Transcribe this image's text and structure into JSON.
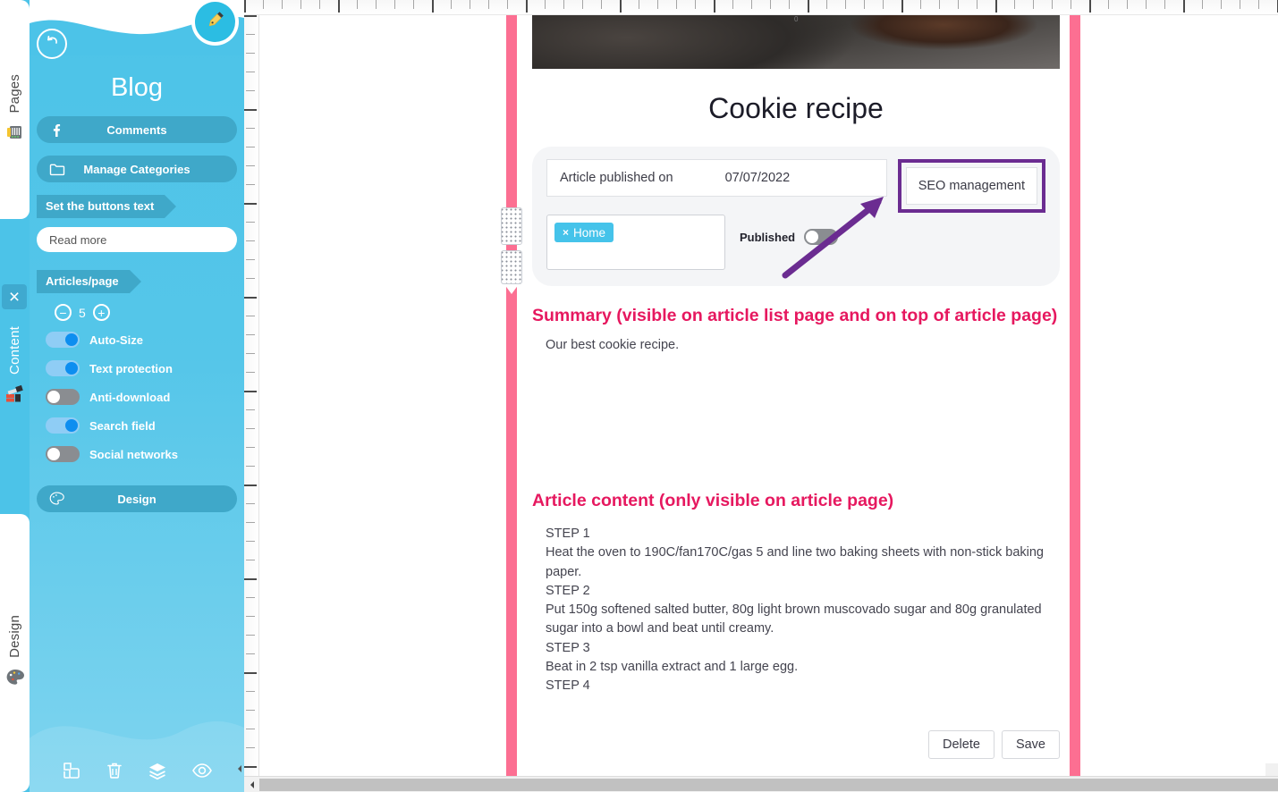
{
  "rail": {
    "tabs": [
      {
        "label": "Pages",
        "icon": "pages-icon",
        "active": false
      },
      {
        "label": "Content",
        "icon": "content-icon",
        "active": true
      },
      {
        "label": "Design",
        "icon": "palette-icon",
        "active": false
      }
    ],
    "close_label": "×"
  },
  "sidebar": {
    "title": "Blog",
    "back_icon": "undo-arrow-icon",
    "pen_icon": "pen-nib-icon",
    "buttons": [
      {
        "label": "Comments",
        "icon": "facebook-icon"
      },
      {
        "label": "Manage Categories",
        "icon": "folder-icon"
      }
    ],
    "buttons_text_tag": "Set the buttons text",
    "read_more": {
      "value": "Read more",
      "placeholder": "Read more"
    },
    "articles_per_page": {
      "tag": "Articles/page",
      "value": "5",
      "minus": "−",
      "plus": "+"
    },
    "toggles": [
      {
        "label": "Auto-Size",
        "state": "on"
      },
      {
        "label": "Text protection",
        "state": "on"
      },
      {
        "label": "Anti-download",
        "state": "off"
      },
      {
        "label": "Search field",
        "state": "on"
      },
      {
        "label": "Social networks",
        "state": "off"
      }
    ],
    "design_button": {
      "label": "Design",
      "icon": "palette-icon"
    },
    "tools": [
      {
        "name": "duplicate-icon"
      },
      {
        "name": "trash-icon"
      },
      {
        "name": "layers-icon"
      },
      {
        "name": "eye-icon"
      }
    ]
  },
  "ruler": {
    "zero_label": "0"
  },
  "article": {
    "hero_image": "cookie-photo",
    "title": "Cookie recipe",
    "published_on_label": "Article published on",
    "published_on_value": "07/07/2022",
    "seo_button": "SEO management",
    "category_chip": {
      "remove": "×",
      "label": "Home"
    },
    "published_toggle": {
      "label": "Published",
      "state": "off"
    },
    "summary_heading": "Summary (visible on article list page and on top of article page)",
    "summary_body": "Our best cookie recipe.",
    "content_heading": "Article content (only visible on article page)",
    "content_body": "STEP 1\nHeat the oven to 190C/fan170C/gas 5 and line two baking sheets with non-stick baking paper.\nSTEP 2\nPut 150g softened salted butter, 80g light brown muscovado sugar and 80g granulated sugar into a bowl and beat until creamy.\nSTEP 3\nBeat in 2 tsp vanilla extract and 1 large egg.\nSTEP 4",
    "delete_button": "Delete",
    "save_button": "Save"
  },
  "colors": {
    "sidebar_blue": "#4cc3e8",
    "pill_blue": "#3fa8c9",
    "accent_pink": "#e6185f",
    "guide_pink": "#fc6f92",
    "annotation_purple": "#6b2c91",
    "toggle_on": "#0d8ef0",
    "chip_blue": "#45c3ea"
  }
}
